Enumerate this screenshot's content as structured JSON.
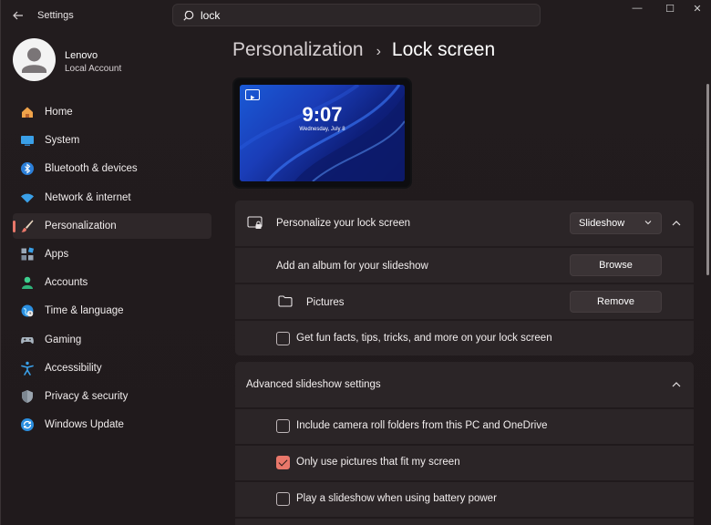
{
  "app": {
    "title": "Settings"
  },
  "search": {
    "value": "lock"
  },
  "window_controls": {
    "minimize": "—",
    "maximize": "☐",
    "close": "✕"
  },
  "profile": {
    "name": "Lenovo",
    "account": "Local Account"
  },
  "sidebar": {
    "items": [
      {
        "label": "Home",
        "icon": "home-icon",
        "active": false
      },
      {
        "label": "System",
        "icon": "system-icon",
        "active": false
      },
      {
        "label": "Bluetooth & devices",
        "icon": "bluetooth-icon",
        "active": false
      },
      {
        "label": "Network & internet",
        "icon": "network-icon",
        "active": false
      },
      {
        "label": "Personalization",
        "icon": "brush-icon",
        "active": true
      },
      {
        "label": "Apps",
        "icon": "apps-icon",
        "active": false
      },
      {
        "label": "Accounts",
        "icon": "accounts-icon",
        "active": false
      },
      {
        "label": "Time & language",
        "icon": "globe-icon",
        "active": false
      },
      {
        "label": "Gaming",
        "icon": "gamepad-icon",
        "active": false
      },
      {
        "label": "Accessibility",
        "icon": "accessibility-icon",
        "active": false
      },
      {
        "label": "Privacy & security",
        "icon": "shield-icon",
        "active": false
      },
      {
        "label": "Windows Update",
        "icon": "update-icon",
        "active": false
      }
    ]
  },
  "breadcrumb": {
    "parent": "Personalization",
    "separator": "›",
    "current": "Lock screen"
  },
  "preview": {
    "time": "9:07",
    "date": "Wednesday, July 8"
  },
  "lock_screen": {
    "personalize_label": "Personalize your lock screen",
    "personalize_value": "Slideshow",
    "album_label": "Add an album for your slideshow",
    "browse_label": "Browse",
    "folder_label": "Pictures",
    "remove_label": "Remove",
    "fun_facts_label": "Get fun facts, tips, tricks, and more on your lock screen",
    "fun_facts_checked": false
  },
  "advanced": {
    "title": "Advanced slideshow settings",
    "options": [
      {
        "label": "Include camera roll folders from this PC and OneDrive",
        "checked": false
      },
      {
        "label": "Only use pictures that fit my screen",
        "checked": true
      },
      {
        "label": "Play a slideshow when using battery power",
        "checked": false
      }
    ]
  },
  "colors": {
    "accent": "#e9776a",
    "background": "#201a1c",
    "card": "#2b2527"
  }
}
